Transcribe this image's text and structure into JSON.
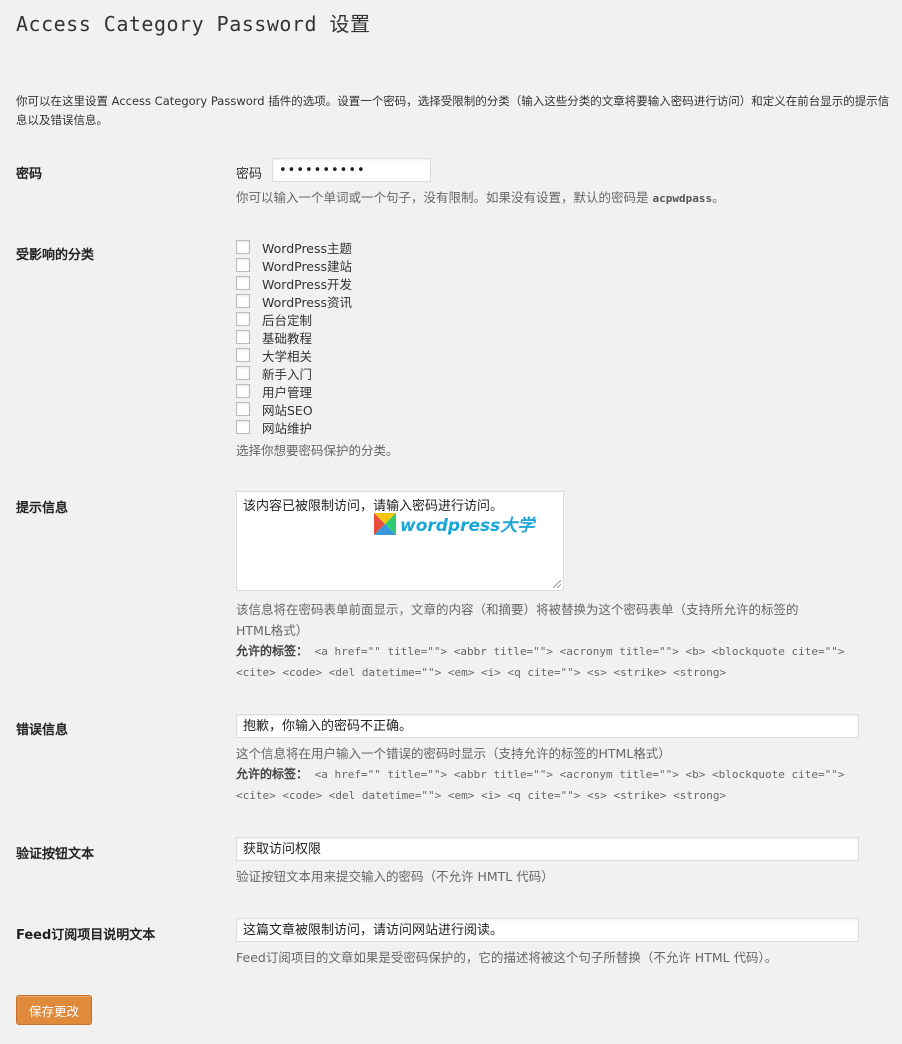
{
  "title": "Access Category Password 设置",
  "intro": "你可以在这里设置 Access Category Password 插件的选项。设置一个密码，选择受限制的分类（输入这些分类的文章将要输入密码进行访问）和定义在前台显示的提示信息以及错误信息。",
  "password": {
    "label": "密码",
    "field_label": "密码",
    "value": "••••••••••",
    "desc_prefix": "你可以输入一个单词或一个句子，没有限制。如果没有设置，默认的密码是 ",
    "default_pw": "acpwdpass",
    "desc_suffix": "。"
  },
  "categories": {
    "label": "受影响的分类",
    "items": [
      {
        "label": "WordPress主题",
        "checked": false
      },
      {
        "label": "WordPress建站",
        "checked": false
      },
      {
        "label": "WordPress开发",
        "checked": false
      },
      {
        "label": "WordPress资讯",
        "checked": false
      },
      {
        "label": "后台定制",
        "checked": false
      },
      {
        "label": "基础教程",
        "checked": false
      },
      {
        "label": "大学相关",
        "checked": false
      },
      {
        "label": "新手入门",
        "checked": false
      },
      {
        "label": "用户管理",
        "checked": false
      },
      {
        "label": "网站SEO",
        "checked": false
      },
      {
        "label": "网站维护",
        "checked": false
      }
    ],
    "desc": "选择你想要密码保护的分类。"
  },
  "hint": {
    "label": "提示信息",
    "value": "该内容已被限制访问，请输入密码进行访问。",
    "desc_line1": "该信息将在密码表单前面显示，文章的内容（和摘要）将被替换为这个密码表单（支持所允许的标签的",
    "desc_line2": "HTML格式）",
    "tags_label": "允许的标签：",
    "tags_line1": " <a href=\"\" title=\"\"> <abbr title=\"\"> <acronym title=\"\"> <b> <blockquote cite=\"\">",
    "tags_line2": "<cite> <code> <del datetime=\"\"> <em> <i> <q cite=\"\"> <s> <strike> <strong>"
  },
  "error": {
    "label": "错误信息",
    "value": "抱歉，你输入的密码不正确。",
    "desc": "这个信息将在用户输入一个错误的密码时显示（支持允许的标签的HTML格式）",
    "tags_label": "允许的标签：",
    "tags_line1": " <a href=\"\" title=\"\"> <abbr title=\"\"> <acronym title=\"\"> <b> <blockquote cite=\"\">",
    "tags_line2": "<cite> <code> <del datetime=\"\"> <em> <i> <q cite=\"\"> <s> <strike> <strong>"
  },
  "button_text": {
    "label": "验证按钮文本",
    "value": "获取访问权限",
    "desc": "验证按钮文本用来提交输入的密码（不允许 HMTL 代码）"
  },
  "feed": {
    "label": "Feed订阅项目说明文本",
    "value": "这篇文章被限制访问，请访问网站进行阅读。",
    "desc": "Feed订阅项目的文章如果是受密码保护的，它的描述将被这个句子所替换（不允许 HTML 代码）。"
  },
  "save_label": "保存更改",
  "watermark": "wordpress大学",
  "colors": {
    "accent": "#e08a3c",
    "watermark": "#1aa7d8"
  }
}
